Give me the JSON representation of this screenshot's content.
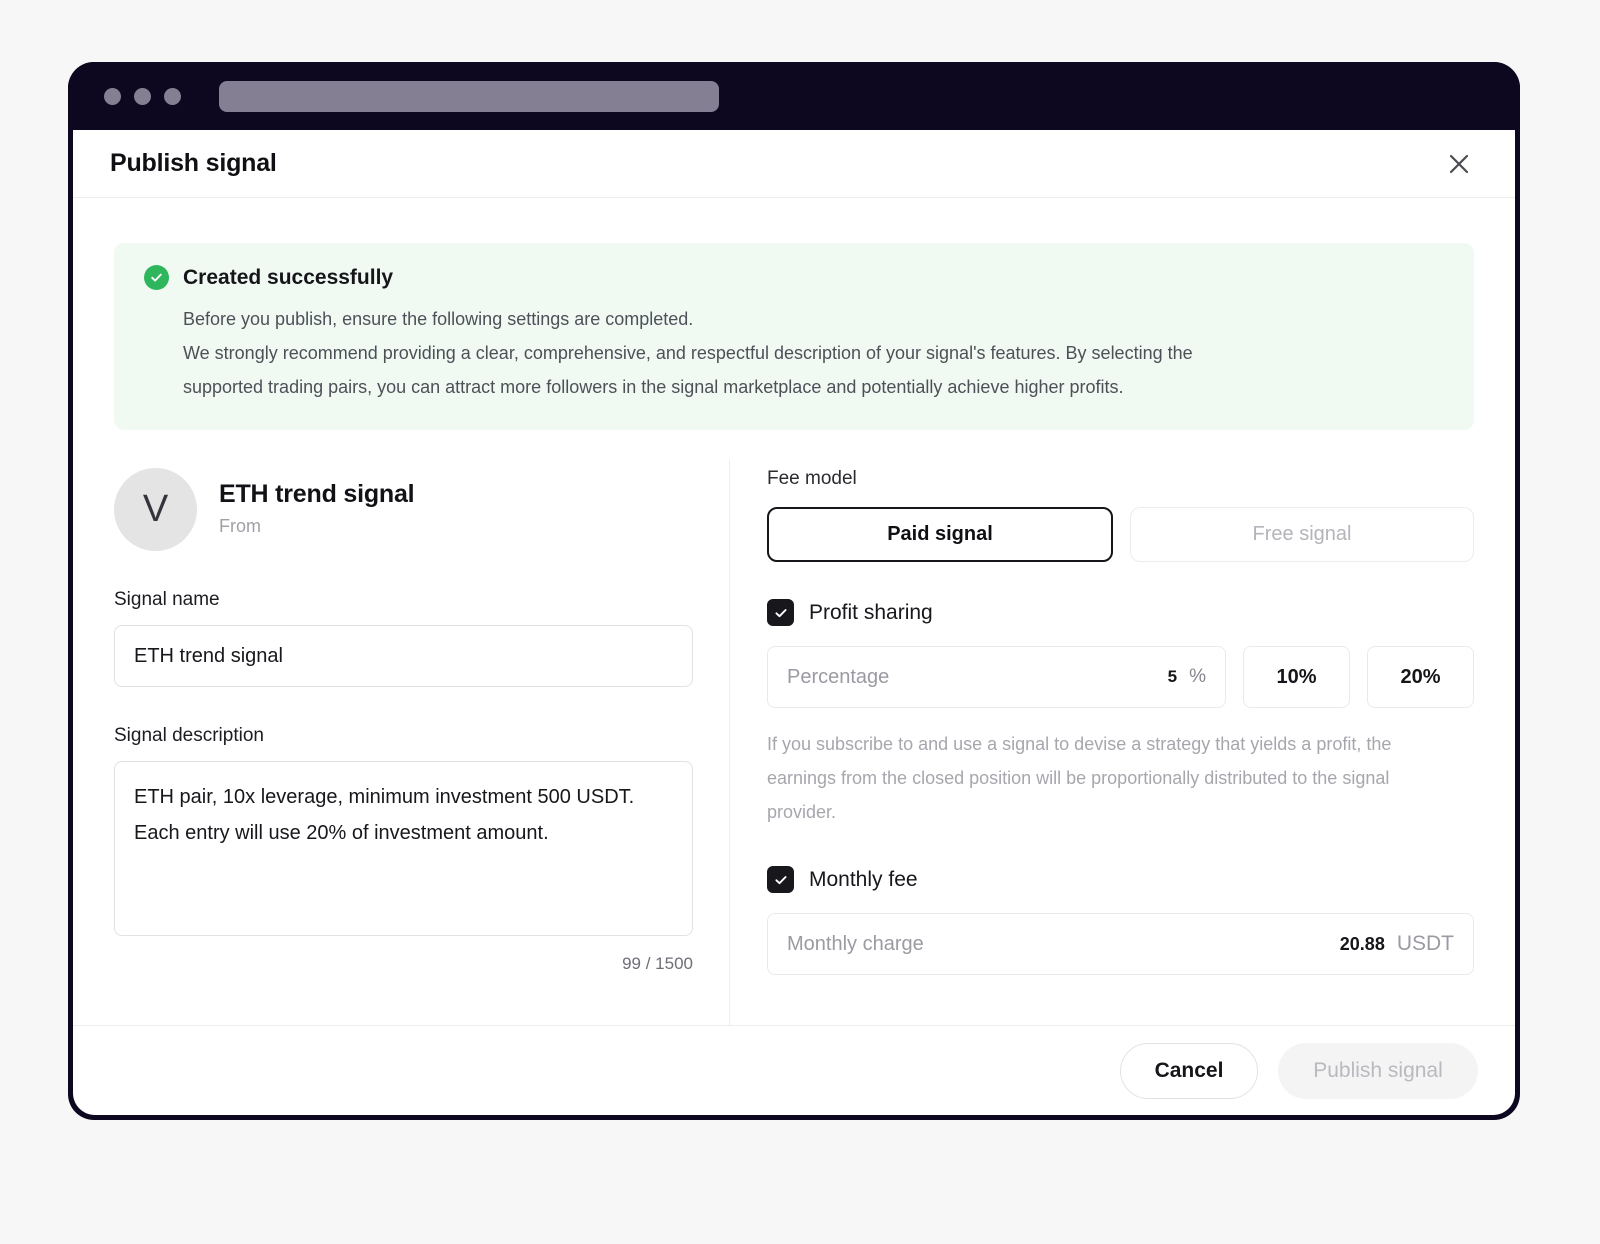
{
  "browser": {
    "traffic_lights": [
      "red-dot",
      "yellow-dot",
      "green-dot"
    ],
    "address_bar_value": ""
  },
  "modal": {
    "title": "Publish signal",
    "close_icon": "close-icon"
  },
  "banner": {
    "icon": "check-circle-icon",
    "title": "Created successfully",
    "lines": [
      "Before you publish, ensure the following settings are completed.",
      "We strongly recommend providing a clear, comprehensive, and respectful description of your signal's features. By selecting the",
      "supported trading pairs, you can attract more followers in the signal marketplace and potentially achieve higher profits."
    ]
  },
  "left": {
    "avatar_initial": "V",
    "profile_name": "ETH trend signal",
    "profile_from": "From",
    "signal_name_label": "Signal name",
    "signal_name_value": "ETH trend signal",
    "signal_name_placeholder": "Signal name",
    "signal_description_label": "Signal description",
    "signal_description_value": "ETH pair, 10x leverage, minimum investment 500 USDT. Each entry will use 20% of investment amount.",
    "signal_description_placeholder": "Signal description",
    "counter": "99 / 1500"
  },
  "right": {
    "fee_model_label": "Fee model",
    "fee_options": [
      {
        "label": "Paid signal",
        "selected": true
      },
      {
        "label": "Free signal",
        "selected": false
      }
    ],
    "profit_sharing": {
      "label": "Profit sharing",
      "checked": true,
      "percentage_placeholder": "Percentage",
      "percentage_value": "5",
      "percentage_unit": "%",
      "presets": [
        "10%",
        "20%"
      ],
      "helper": "If you subscribe to and use a signal to devise a strategy that yields a profit, the earnings from the closed position will be proportionally distributed to the signal provider."
    },
    "monthly_fee": {
      "label": "Monthly fee",
      "checked": true,
      "charge_placeholder": "Monthly charge",
      "charge_value": "20.88",
      "charge_unit": "USDT"
    }
  },
  "footer": {
    "cancel_label": "Cancel",
    "publish_label": "Publish signal",
    "publish_disabled": true
  },
  "colors": {
    "window_chrome": "#0d0720",
    "success_green": "#2eb65c",
    "banner_bg": "#f0faf3",
    "accent_dark": "#16161a",
    "muted_text": "#a6a6ad"
  }
}
